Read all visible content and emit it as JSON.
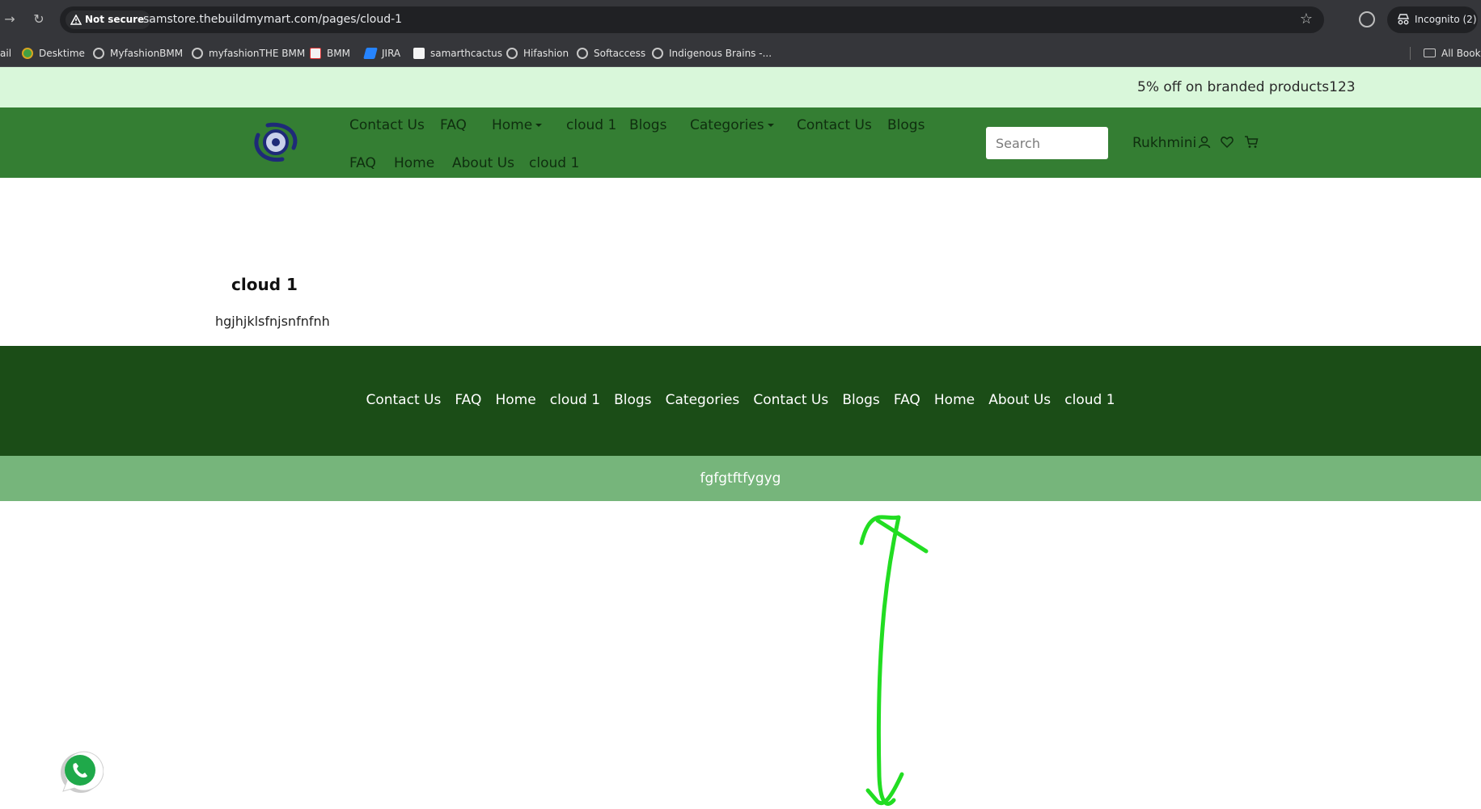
{
  "browser": {
    "not_secure_label": "Not secure",
    "url": "samstore.thebuildmymart.com/pages/cloud-1",
    "incognito_label": "Incognito (2)",
    "bookmarks": [
      {
        "label": "ail",
        "icon": "none"
      },
      {
        "label": "Desktime",
        "icon": "desktime-icon"
      },
      {
        "label": "MyfashionBMM",
        "icon": "globe-icon"
      },
      {
        "label": "myfashionTHE BMM",
        "icon": "globe-icon"
      },
      {
        "label": "BMM",
        "icon": "bmm-icon"
      },
      {
        "label": "JIRA",
        "icon": "jira-icon"
      },
      {
        "label": "samarthcactus",
        "icon": "cactus-icon"
      },
      {
        "label": "Hifashion",
        "icon": "globe-icon"
      },
      {
        "label": "Softaccess",
        "icon": "globe-icon"
      },
      {
        "label": "Indigenous Brains -...",
        "icon": "globe-icon"
      }
    ],
    "all_bookmarks_label": "All Bookn"
  },
  "promo": {
    "text": "5% off on branded products123"
  },
  "header": {
    "nav_row1": [
      "Contact Us",
      "FAQ",
      "Home",
      "cloud 1",
      "Blogs",
      "Categories",
      "Contact Us",
      "Blogs"
    ],
    "nav_row2": [
      "FAQ",
      "Home",
      "About Us",
      "cloud 1"
    ],
    "search_placeholder": "Search",
    "user_name": "Rukhmini"
  },
  "page": {
    "title": "cloud 1",
    "body": "hgjhjklsfnjsnfnfnh"
  },
  "footer": {
    "links": [
      "Contact Us",
      "FAQ",
      "Home",
      "cloud 1",
      "Blogs",
      "Categories",
      "Contact Us",
      "Blogs",
      "FAQ",
      "Home",
      "About Us",
      "cloud 1"
    ],
    "sub_text": "fgfgtftfygyg"
  },
  "colors": {
    "promo_bg": "#d9f7da",
    "header_bg": "#347e33",
    "footer_bg": "#1b4d17",
    "sub_footer_bg": "#76b57b",
    "annotation": "#22dd22"
  }
}
